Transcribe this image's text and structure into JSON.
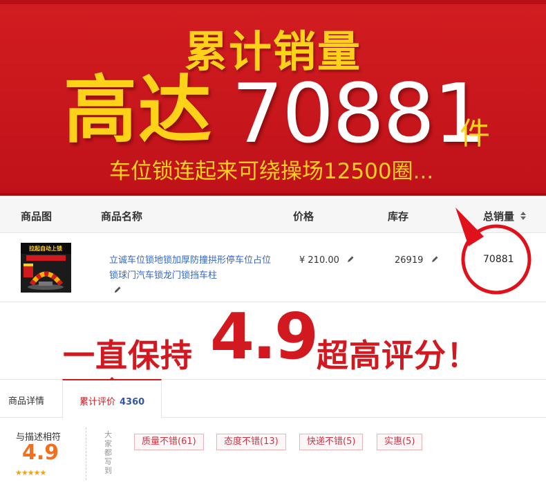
{
  "banner": {
    "title": "累计销量",
    "prefix": "高达",
    "number": "70881",
    "unit": "件",
    "subtitle": "车位锁连起来可绕操场12500圈..."
  },
  "table": {
    "headers": {
      "image": "商品图",
      "name": "商品名称",
      "price": "价格",
      "stock": "库存",
      "sales": "总销量"
    },
    "row": {
      "thumb_text_top": "拉起自动上锁",
      "name": "立诚车位锁地锁加厚防撞拱形停车位占位锁球门汽车锁龙门锁挡车柱",
      "price": "¥ 210.00",
      "stock": "26919",
      "sales": "70881"
    }
  },
  "rating_banner": {
    "pre": "一直保持",
    "score": "4.9",
    "post": "超高评分！"
  },
  "tabs": {
    "detail": "商品详情",
    "review": "累计评价",
    "review_count": "4360"
  },
  "review_summary": {
    "desc_label": "与描述相符",
    "score": "4.9",
    "stars": "★★★★★",
    "side_label": "大家都写到",
    "tags": [
      "质量不错(61)",
      "态度不错(13)",
      "快递不错(5)",
      "实惠(5)"
    ]
  },
  "colors": {
    "banner_red": "#c8141a",
    "banner_yellow": "#ffd21a",
    "accent_red": "#d31920",
    "link_blue": "#3366cc",
    "score_orange": "#f2701d"
  }
}
